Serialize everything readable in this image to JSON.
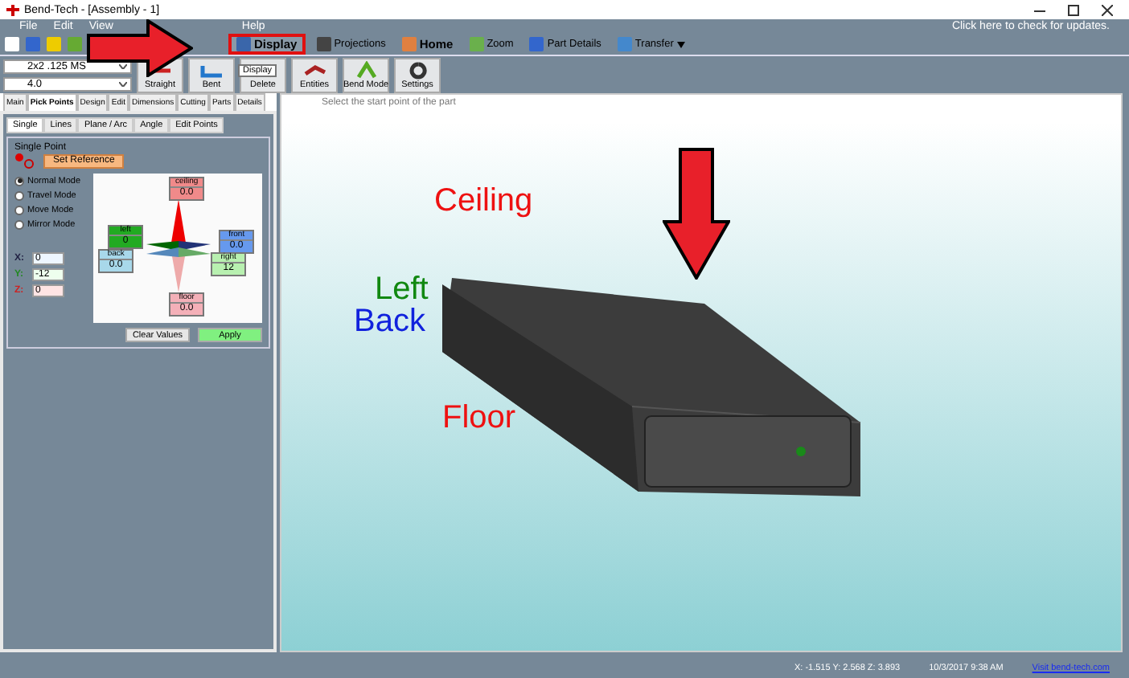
{
  "window": {
    "title": "Bend-Tech - [Assembly - 1]"
  },
  "menu": [
    "File",
    "Edit",
    "View",
    "Help"
  ],
  "update_notice": "Click here to check for updates.",
  "toolbar": [
    {
      "kind": "highlighted",
      "label": "Display"
    },
    {
      "kind": "plain",
      "label": "Projections"
    },
    {
      "kind": "bold",
      "label": "Home"
    },
    {
      "kind": "plain",
      "label": "Zoom"
    },
    {
      "kind": "plain",
      "label": "Part Details"
    },
    {
      "kind": "dropdown",
      "label": "Transfer"
    }
  ],
  "tooltip": "Display",
  "selectors": [
    {
      "value": "2x2 .125 MS"
    },
    {
      "value": "4.0"
    }
  ],
  "tools": [
    "Straight",
    "Bent",
    "Delete",
    "Entities",
    "Bend Mode",
    "Settings"
  ],
  "tabs": [
    {
      "label": "Main",
      "selected": false
    },
    {
      "label": "Pick Points",
      "selected": true
    },
    {
      "label": "Design",
      "selected": false
    },
    {
      "label": "Edit",
      "selected": false
    },
    {
      "label": "Dimensions",
      "selected": false
    },
    {
      "label": "Cutting",
      "selected": false
    },
    {
      "label": "Parts",
      "selected": false
    },
    {
      "label": "Details",
      "selected": false
    }
  ],
  "subtabs": [
    {
      "label": "Single",
      "selected": true
    },
    {
      "label": "Lines",
      "selected": false
    },
    {
      "label": "Plane / Arc",
      "selected": false
    },
    {
      "label": "Angle",
      "selected": false
    },
    {
      "label": "Edit Points",
      "selected": false
    }
  ],
  "group": {
    "title": "Single Point",
    "reference_button": "Set Reference",
    "modes": [
      {
        "label": "Normal Mode",
        "selected": true
      },
      {
        "label": "Travel Mode",
        "selected": false
      },
      {
        "label": "Move Mode",
        "selected": false
      },
      {
        "label": "Mirror Mode",
        "selected": false
      }
    ],
    "directions": [
      {
        "name": "ceiling",
        "value": "0.0",
        "color": "#f08a8a"
      },
      {
        "name": "left",
        "value": "0",
        "color": "#22aa22"
      },
      {
        "name": "front",
        "value": "0.0",
        "color": "#6699ee"
      },
      {
        "name": "back",
        "value": "0.0",
        "color": "#a8d8ea"
      },
      {
        "name": "right",
        "value": "12",
        "color": "#b8f0b0"
      },
      {
        "name": "floor",
        "value": "0.0",
        "color": "#f4b0b8"
      }
    ],
    "coords": [
      {
        "axis": "X:",
        "value": "0",
        "color": "#eef6ff"
      },
      {
        "axis": "Y:",
        "value": "-12",
        "color": "#eeffee"
      },
      {
        "axis": "Z:",
        "value": "0",
        "color": "#ffe4e4"
      }
    ],
    "buttons": [
      {
        "label": "Clear Values",
        "kind": "plain"
      },
      {
        "label": "Apply",
        "kind": "primary"
      }
    ]
  },
  "viewport": {
    "instruction": "Select the start point of the part",
    "labels": [
      {
        "text": "Ceiling",
        "color": "#ee1111"
      },
      {
        "text": "Left",
        "color": "#118811"
      },
      {
        "text": "Back",
        "color": "#1122dd"
      },
      {
        "text": "Floor",
        "color": "#ee1111"
      }
    ]
  },
  "status_bar": {
    "coordinates": "X: -1.515  Y: 2.568  Z: 3.893",
    "datetime": "10/3/2017  9:38 AM",
    "link": "Visit bend-tech.com"
  }
}
